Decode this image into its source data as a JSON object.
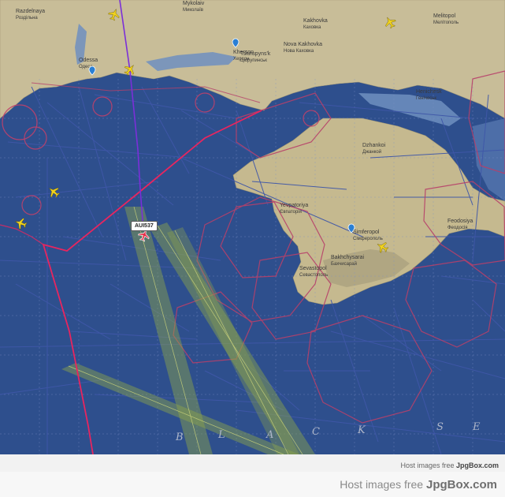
{
  "map": {
    "cities": [
      {
        "name": "Mykolaiv",
        "name_local": "Миколаїв"
      },
      {
        "name": "Kherson",
        "name_local": "Херсон"
      },
      {
        "name": "Odessa",
        "name_local": "Одеса"
      },
      {
        "name": "Nova Kakhovka",
        "name_local": "Нова Каховка"
      },
      {
        "name": "Kakhovka",
        "name_local": "Каховка"
      },
      {
        "name": "Melitopol",
        "name_local": "Мелітополь"
      },
      {
        "name": "Tsiurupyns'k",
        "name_local": "Цюрупинськ"
      },
      {
        "name": "Yevpatoriya",
        "name_local": "Євпаторія"
      },
      {
        "name": "Simferopol",
        "name_local": "Сімферополь"
      },
      {
        "name": "Sevastopol",
        "name_local": "Севастополь"
      },
      {
        "name": "Bakhchysarai",
        "name_local": "Бахчисарай"
      },
      {
        "name": "Dzhankoi",
        "name_local": "Джанкой"
      },
      {
        "name": "Feodosiya",
        "name_local": "Феодосія"
      },
      {
        "name": "Razdelnaya",
        "name_local": "Роздільна"
      },
      {
        "name": "Henichesk",
        "name_local": "Генічеськ"
      }
    ],
    "chart_letters": [
      "B",
      "L",
      "A",
      "C",
      "K",
      "S",
      "E"
    ],
    "flight": {
      "callsign": "AUI537"
    },
    "aircraft_icon": "airplane-icon",
    "airport_icon": "airport-pin-icon",
    "colors": {
      "sea": "#2d4f8c",
      "land": "#c4b791",
      "airway": "#3a4f9a",
      "restricted_zone": "#c0406a",
      "fir_boundary": "#e82560",
      "flight_track": "#7b2fd8",
      "corridor": "#8ea64a"
    }
  },
  "watermark": {
    "small_prefix": "Host images free ",
    "small_brand": "JpgBox.com",
    "large_prefix": "Host images free ",
    "large_brand": "JpgBox.com"
  }
}
